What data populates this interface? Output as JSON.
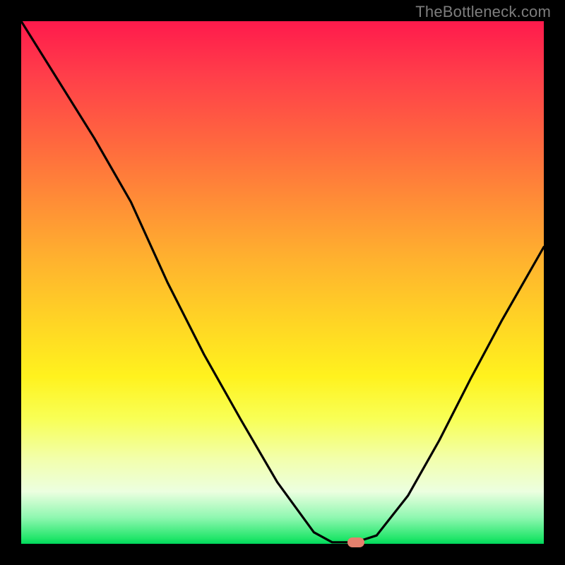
{
  "watermark": "TheBottleneck.com",
  "domain_note": "Bottleneck curve chart with heatmap gradient background",
  "marker": {
    "x_norm": 0.64,
    "y_norm": 0.997,
    "color": "#e5806d"
  },
  "chart_data": {
    "type": "line",
    "title": "",
    "xlabel": "",
    "ylabel": "",
    "xlim": [
      0,
      1
    ],
    "ylim": [
      0,
      1
    ],
    "grid": false,
    "legend": false,
    "background_gradient": {
      "direction": "vertical",
      "stops": [
        {
          "pos": 0.0,
          "color": "#ff1a4c"
        },
        {
          "pos": 0.35,
          "color": "#ff8f36"
        },
        {
          "pos": 0.68,
          "color": "#fff21e"
        },
        {
          "pos": 0.9,
          "color": "#ecffe0"
        },
        {
          "pos": 1.0,
          "color": "#00d85c"
        }
      ]
    },
    "series": [
      {
        "name": "bottleneck-curve",
        "x": [
          0.0,
          0.07,
          0.14,
          0.21,
          0.28,
          0.35,
          0.42,
          0.49,
          0.56,
          0.595,
          0.64,
          0.68,
          0.74,
          0.8,
          0.86,
          0.92,
          1.0
        ],
        "y": [
          1.0,
          0.888,
          0.776,
          0.654,
          0.5,
          0.362,
          0.238,
          0.118,
          0.022,
          0.003,
          0.003,
          0.016,
          0.092,
          0.198,
          0.316,
          0.428,
          0.568
        ]
      }
    ],
    "marker_point": {
      "x": 0.64,
      "y": 0.003
    }
  }
}
